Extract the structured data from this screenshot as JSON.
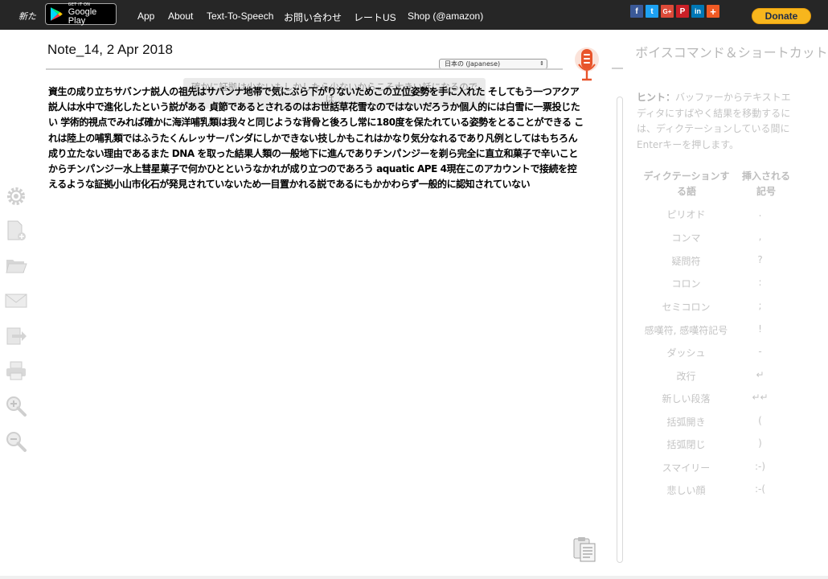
{
  "topbar": {
    "new_label": "新た",
    "google_play_small": "GET IT ON",
    "google_play_big": "Google Play",
    "nav": [
      "App",
      "About",
      "Text-To-Speech",
      "お問い合わせ",
      "レートUS",
      "Shop (@amazon)"
    ],
    "social": [
      {
        "name": "facebook",
        "glyph": "f",
        "color": "#3b5998"
      },
      {
        "name": "twitter",
        "glyph": "t",
        "color": "#1da1f2"
      },
      {
        "name": "googleplus",
        "glyph": "G+",
        "color": "#dd4b39"
      },
      {
        "name": "pinterest",
        "glyph": "P",
        "color": "#cb2027"
      },
      {
        "name": "linkedin",
        "glyph": "in",
        "color": "#0077b5"
      },
      {
        "name": "more",
        "glyph": "+",
        "color": "#f05a24"
      }
    ],
    "donate": "Donate"
  },
  "editor": {
    "title": "Note_14, 2 Apr 2018",
    "language": "日本の (Japanese)",
    "ghost_text": "確かに証拠は少ないもしかしたら少ないからこそ大きい話になるのでは…",
    "content": "資生の成り立ちサバンナ説人の祖先はサバンナ地帯で気にぶら下がりないためこの立位姿勢を手に入れた そしてもう一つアクア説人は水中で進化したという説がある 貞節であるとされるのはお世話草花雪なのではないだろうか個人的には白雪に一票投じたい 学術的視点でみれば確かに海洋哺乳類は我々と同じような背骨と後ろし常に180度を保たれている姿勢をとることができる これは陸上の哺乳類ではふうたくんレッサーパンダにしかできない技しかもこれはかなり気分なれるであり凡例としてはもちろん成り立たない理由であるまた DNA を取った結果人類の一般地下に進んでありチンパンジーを剃ら完全に直立和菓子で辛いことからチンパンジー水上彗星菓子で何かひとというなかれが成り立つのであろう aquatic APE 4現在このアカウントで接続を控えるような証拠小山市化石が発見されていないため一目置かれる説であるにもかかわらず一般的に認知されていない"
  },
  "panel": {
    "title": "ボイスコマンド＆ショートカット",
    "hint_label": "ヒント：",
    "hint_text": "バッファーからテキストエディタにすばやく結果を移動するには、ディクテーションしている間にEnterキーを押します。",
    "col_dictation": "ディクテーションする語",
    "col_inserted": "挿入される記号",
    "commands": [
      {
        "word": "ピリオド",
        "symbol": "."
      },
      {
        "word": "コンマ",
        "symbol": ","
      },
      {
        "word": "疑問符",
        "symbol": "?"
      },
      {
        "word": "コロン",
        "symbol": ":"
      },
      {
        "word": "セミコロン",
        "symbol": ";"
      },
      {
        "word": "感嘆符, 感嘆符記号",
        "symbol": "!"
      },
      {
        "word": "ダッシュ",
        "symbol": "-"
      },
      {
        "word": "改行",
        "symbol": "↵"
      },
      {
        "word": "新しい段落",
        "symbol": "↵↵"
      },
      {
        "word": "括弧開き",
        "symbol": "("
      },
      {
        "word": "括弧閉じ",
        "symbol": ")"
      },
      {
        "word": "スマイリー",
        "symbol": ":-)"
      },
      {
        "word": "悲しい顔",
        "symbol": ":-("
      }
    ]
  },
  "tools": [
    "settings-icon",
    "new-document-icon",
    "open-folder-icon",
    "email-icon",
    "share-icon",
    "print-icon",
    "zoom-in-icon",
    "zoom-out-icon"
  ],
  "colors": {
    "topbar": "#262626",
    "donate": "#f7b61d",
    "mic": "#e8542a"
  }
}
